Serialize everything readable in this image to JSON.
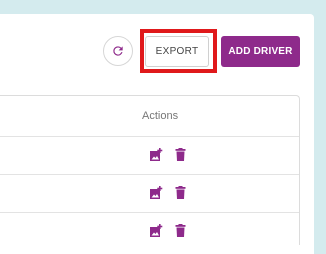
{
  "toolbar": {
    "export_label": "EXPORT",
    "add_driver_label": "ADD DRIVER"
  },
  "table": {
    "actions_header": "Actions",
    "rows": [
      {
        "actions": [
          "add-image-icon",
          "delete-icon"
        ]
      },
      {
        "actions": [
          "add-image-icon",
          "delete-icon"
        ]
      },
      {
        "actions": [
          "add-image-icon",
          "delete-icon"
        ]
      }
    ]
  },
  "colors": {
    "accent": "#8e2a8b",
    "highlight": "#e0191b",
    "background": "#d4ebee"
  }
}
